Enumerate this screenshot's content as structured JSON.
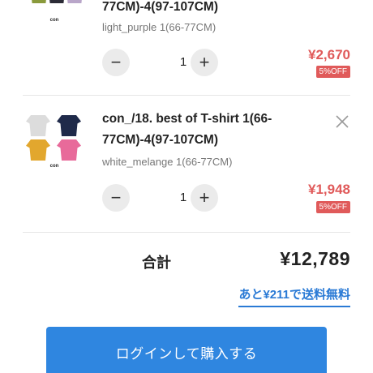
{
  "cart": {
    "items": [
      {
        "name_line2": "77CM)-4(97-107CM)",
        "variant": "light_purple 1(66-77CM)",
        "quantity": "1",
        "price": "¥2,670",
        "discount_badge": "5%OFF",
        "thumb_colors": [
          "#8a9a3c",
          "#2b2b36",
          "#b9a6c9"
        ],
        "brand_mark": "con"
      },
      {
        "name": "con_/18. best of T-shirt 1(66-77CM)-4(97-107CM)",
        "variant": "white_melange 1(66-77CM)",
        "quantity": "1",
        "price": "¥1,948",
        "discount_badge": "5%OFF",
        "thumb_colors": [
          "#dcdcdc",
          "#1f2a4a",
          "#e2a72e",
          "#e86a9a"
        ],
        "brand_mark": "con"
      }
    ],
    "stepper": {
      "minus_symbol": "−",
      "plus_symbol": "+"
    },
    "total": {
      "label": "合計",
      "value": "¥12,789"
    },
    "free_shipping_text": "あと¥211で送料無料",
    "login_button_label": "ログインして購入する"
  },
  "colors": {
    "accent_blue": "#2f86e0",
    "link_blue": "#2a7ad5",
    "sale_red": "#e05a5a"
  },
  "icons": {
    "remove_item": "close-icon",
    "decrement": "minus-icon",
    "increment": "plus-icon"
  }
}
